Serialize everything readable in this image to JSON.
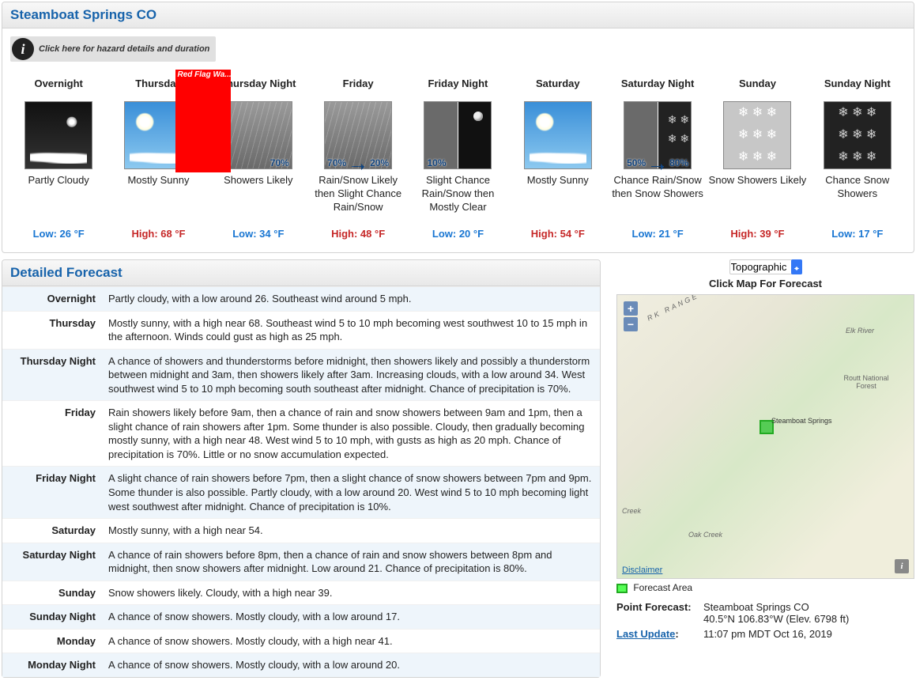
{
  "location_title": "Steamboat Springs CO",
  "hazard_link": "Click here for hazard details and duration",
  "red_flag": "Red Flag Wa...",
  "periods": [
    {
      "name": "Overnight",
      "desc": "Partly Cloudy",
      "temp": "Low: 26 °F",
      "hi": false,
      "art": "night-sky clouds"
    },
    {
      "name": "Thursday",
      "desc": "Mostly Sunny",
      "temp": "High: 68 °F",
      "hi": true,
      "art": "day-sky",
      "flag": true
    },
    {
      "name": "Thursday Night",
      "desc": "Showers Likely",
      "temp": "Low: 34 °F",
      "hi": false,
      "art": "gray-rain",
      "pop_right": "70%"
    },
    {
      "name": "Friday",
      "desc": "Rain/Snow Likely then Slight Chance Rain/Snow",
      "temp": "High: 48 °F",
      "hi": true,
      "art": "gray-rain",
      "pop_left": "70%",
      "pop_right": "20%",
      "arrow": true
    },
    {
      "name": "Friday Night",
      "desc": "Slight Chance Rain/Snow then Mostly Clear",
      "temp": "Low: 20 °F",
      "hi": false,
      "art": "half-night",
      "pop_left": "10%",
      "split": true
    },
    {
      "name": "Saturday",
      "desc": "Mostly Sunny",
      "temp": "High: 54 °F",
      "hi": true,
      "art": "day-sky"
    },
    {
      "name": "Saturday Night",
      "desc": "Chance Rain/Snow then Snow Showers",
      "temp": "Low: 21 °F",
      "hi": false,
      "art": "half-snow",
      "pop_left": "50%",
      "pop_right": "80%",
      "arrow": true,
      "split": true
    },
    {
      "name": "Sunday",
      "desc": "Snow Showers Likely",
      "temp": "High: 39 °F",
      "hi": true,
      "art": "snow-day"
    },
    {
      "name": "Sunday Night",
      "desc": "Chance Snow Showers",
      "temp": "Low: 17 °F",
      "hi": false,
      "art": "snow-night"
    }
  ],
  "detailed_title": "Detailed Forecast",
  "details": [
    {
      "label": "Overnight",
      "text": "Partly cloudy, with a low around 26. Southeast wind around 5 mph."
    },
    {
      "label": "Thursday",
      "text": "Mostly sunny, with a high near 68. Southeast wind 5 to 10 mph becoming west southwest 10 to 15 mph in the afternoon. Winds could gust as high as 25 mph."
    },
    {
      "label": "Thursday Night",
      "text": "A chance of showers and thunderstorms before midnight, then showers likely and possibly a thunderstorm between midnight and 3am, then showers likely after 3am. Increasing clouds, with a low around 34. West southwest wind 5 to 10 mph becoming south southeast after midnight. Chance of precipitation is 70%."
    },
    {
      "label": "Friday",
      "text": "Rain showers likely before 9am, then a chance of rain and snow showers between 9am and 1pm, then a slight chance of rain showers after 1pm. Some thunder is also possible. Cloudy, then gradually becoming mostly sunny, with a high near 48. West wind 5 to 10 mph, with gusts as high as 20 mph. Chance of precipitation is 70%. Little or no snow accumulation expected."
    },
    {
      "label": "Friday Night",
      "text": "A slight chance of rain showers before 7pm, then a slight chance of snow showers between 7pm and 9pm. Some thunder is also possible. Partly cloudy, with a low around 20. West wind 5 to 10 mph becoming light west southwest after midnight. Chance of precipitation is 10%."
    },
    {
      "label": "Saturday",
      "text": "Mostly sunny, with a high near 54."
    },
    {
      "label": "Saturday Night",
      "text": "A chance of rain showers before 8pm, then a chance of rain and snow showers between 8pm and midnight, then snow showers after midnight. Low around 21. Chance of precipitation is 80%."
    },
    {
      "label": "Sunday",
      "text": "Snow showers likely. Cloudy, with a high near 39."
    },
    {
      "label": "Sunday Night",
      "text": "A chance of snow showers. Mostly cloudy, with a low around 17."
    },
    {
      "label": "Monday",
      "text": "A chance of snow showers. Mostly cloudy, with a high near 41."
    },
    {
      "label": "Monday Night",
      "text": "A chance of snow showers. Mostly cloudy, with a low around 20."
    }
  ],
  "map": {
    "basemap_option": "Topographic",
    "click_label": "Click Map For Forecast",
    "disclaimer": "Disclaimer",
    "forecast_area_label": "Forecast Area",
    "town": "Steamboat Springs",
    "forest": "Routt National Forest",
    "range": "RK RANGE",
    "river": "Elk River",
    "creek1": "Creek",
    "creek2": "Oak Creek"
  },
  "point": {
    "pf_label": "Point Forecast:",
    "pf_name": "Steamboat Springs CO",
    "pf_coords": "40.5°N 106.83°W (Elev. 6798 ft)",
    "lu_label": "Last Update",
    "lu_value": "11:07 pm MDT Oct 16, 2019"
  }
}
